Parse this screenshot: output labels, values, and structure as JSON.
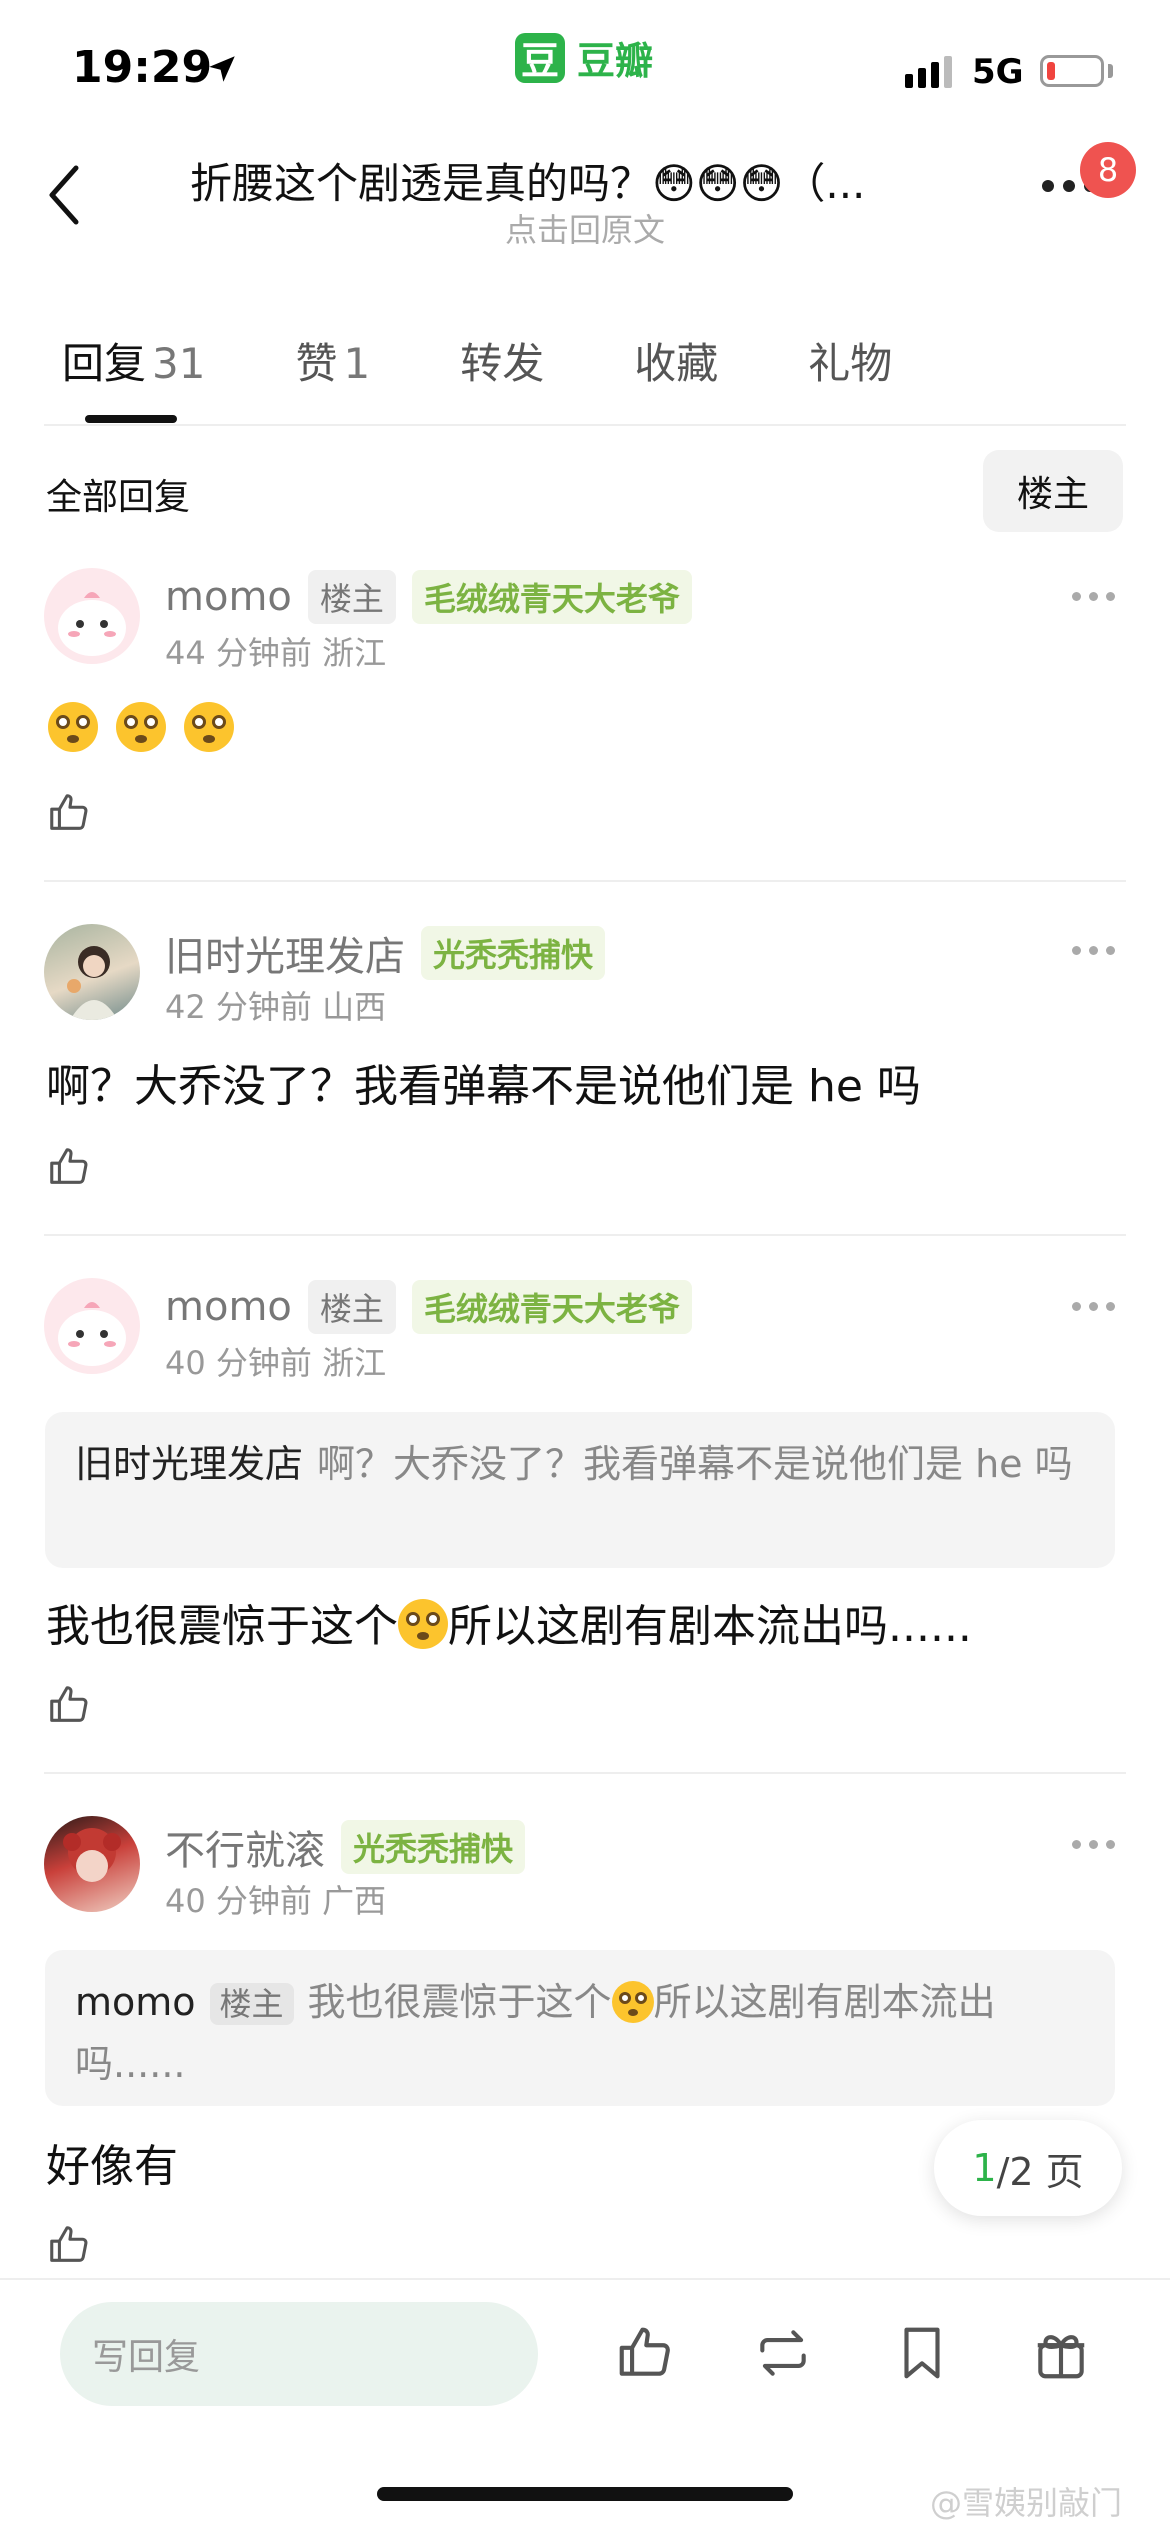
{
  "status_bar": {
    "time": "19:29",
    "network": "5G",
    "battery_level": 0.15,
    "battery_color": "#f0443f"
  },
  "app": {
    "logo_char": "豆",
    "name": "豆瓣",
    "brand_color": "#2db34a"
  },
  "header": {
    "title": "折腰这个剧透是真的吗？😳😳😳（...",
    "subtitle": "点击回原文",
    "notification_count": "8"
  },
  "tabs": [
    {
      "label": "回复",
      "count": "31"
    },
    {
      "label": "赞",
      "count": "1"
    },
    {
      "label": "转发",
      "count": ""
    },
    {
      "label": "收藏",
      "count": ""
    },
    {
      "label": "礼物",
      "count": ""
    }
  ],
  "filter": {
    "all_label": "全部回复",
    "op_only_label": "楼主"
  },
  "comments": [
    {
      "username": "momo",
      "op_tag": "楼主",
      "badge": "毛绒绒青天大老爷",
      "time_loc": "44 分钟前 浙江",
      "content": ""
    },
    {
      "username": "旧时光理发店",
      "op_tag": "",
      "badge": "光秃秃捕快",
      "time_loc": "42 分钟前 山西",
      "content": "啊？大乔没了？我看弹幕不是说他们是 he 吗"
    },
    {
      "username": "momo",
      "op_tag": "楼主",
      "badge": "毛绒绒青天大老爷",
      "time_loc": "40 分钟前 浙江",
      "quote_name": "旧时光理发店",
      "quote_text": "啊？大乔没了？我看弹幕不是说他们是 he 吗",
      "content_a": "我也很震惊于这个",
      "content_b": "所以这剧有剧本流出吗......"
    },
    {
      "username": "不行就滚",
      "op_tag": "",
      "badge": "光秃秃捕快",
      "time_loc": "40 分钟前 广西",
      "quote_name": "momo",
      "quote_tag": "楼主",
      "quote_text_a": "我也很震惊于这个",
      "quote_text_b": "所以这剧有剧本流出吗......",
      "content": "好像有"
    }
  ],
  "pager": {
    "current": "1",
    "rest": "/2 页"
  },
  "bottom_bar": {
    "reply_placeholder": "写回复"
  },
  "watermark": "@雪姨别敲门",
  "icons": [
    "location-arrow-icon",
    "back-chevron-icon",
    "more-icon",
    "like-icon",
    "repost-icon",
    "bookmark-icon",
    "gift-icon",
    "flushed-face-emoji"
  ]
}
